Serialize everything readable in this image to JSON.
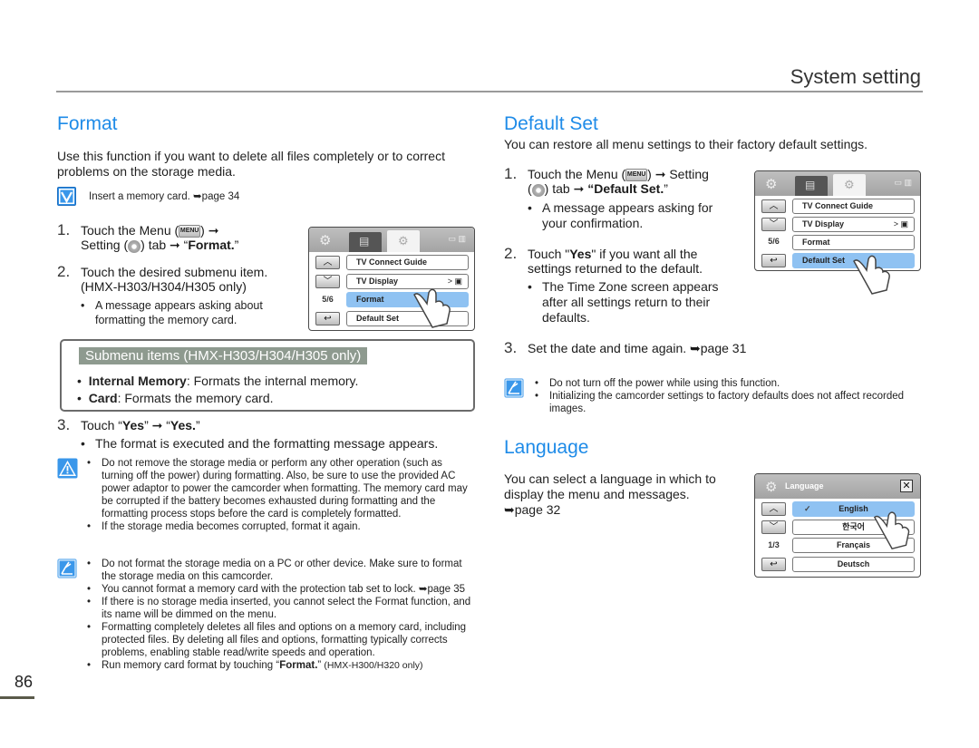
{
  "header": {
    "title": "System setting"
  },
  "page_number": "86",
  "format": {
    "title": "Format",
    "intro": "Use this function if you want to delete all files completely or to correct problems on the storage media.",
    "precheck": {
      "icon": "checkmark-icon",
      "text": "Insert a memory card. ➥page 34"
    },
    "step1": {
      "num": "1.",
      "a": "Touch the Menu (",
      "menu_key": "MENU",
      "b": ") ➞",
      "c": "Setting (",
      "d": ") tab ➞ “",
      "bold": "Format.",
      "e": "”"
    },
    "step2": {
      "num": "2.",
      "line1": "Touch the desired submenu item.",
      "line2": "(HMX-H303/H304/H305 only)"
    },
    "step2_bullet": "A message appears asking about formatting the memory card.",
    "screen": {
      "items": [
        "TV Connect Guide",
        "TV Display",
        "Format",
        "Default Set"
      ],
      "selected_index": 2,
      "page_indicator": "5/6",
      "tv_display_value": ">"
    },
    "submenu": {
      "title": "Submenu items (HMX-H303/H304/H305 only)",
      "items": [
        {
          "bold": "Internal Memory",
          "text": ": Formats the internal memory."
        },
        {
          "bold": "Card",
          "text": ": Formats the memory card."
        }
      ]
    },
    "step3": {
      "num": "3.",
      "a": "Touch “",
      "yes1": "Yes",
      "b": "” ➞ “",
      "yes2": "Yes.",
      "c": "”"
    },
    "step3_bullet": "The format is executed and the formatting message appears.",
    "cautions": [
      "Do not remove the storage media or perform any other operation (such as turning off the power) during formatting. Also, be sure to use the provided AC power adaptor to power the camcorder when formatting. The memory card may be corrupted if the battery becomes exhausted during formatting and the formatting process stops before the card is completely formatted.",
      "If the storage media becomes corrupted, format it again."
    ],
    "notes": [
      "Do not format the storage media on a PC or other device. Make sure to format the storage media on this camcorder.",
      "You cannot format a memory card with the protection tab set to lock. ➥page 35",
      "If there is no storage media inserted, you cannot select the Format function, and its name will be dimmed on the menu.",
      "Formatting completely deletes all files and options on a memory card, including protected files. By deleting all files and options, formatting typically corrects problems, enabling stable read/write speeds and operation."
    ],
    "last_note": {
      "a": "Run memory card format by touching “",
      "bold": "Format.",
      "b": "” ",
      "c": "(HMX-H300/H320 only)"
    }
  },
  "default_set": {
    "title": "Default Set",
    "intro": "You can restore all menu settings to their factory default settings.",
    "step1": {
      "num": "1.",
      "a": "Touch the Menu (",
      "menu_key": "MENU",
      "b": ") ➞ Setting",
      "c": "(",
      "d": ") tab ➞ ",
      "bold": "“Default Set.",
      "e": "”"
    },
    "step1_bullet": "A message appears asking for your confirmation.",
    "step2": {
      "num": "2.",
      "a": "Touch \"",
      "bold": "Yes",
      "b": "\" if you want all the settings returned to the default."
    },
    "step2_bullet": "The Time Zone screen appears after all settings return to their defaults.",
    "step3": {
      "num": "3.",
      "text": "Set the date and time again. ➥page 31"
    },
    "screen": {
      "items": [
        "TV Connect Guide",
        "TV Display",
        "Format",
        "Default Set"
      ],
      "selected_index": 3,
      "page_indicator": "5/6"
    },
    "notes": [
      "Do not turn off the power while using this function.",
      "Initializing the camcorder settings to factory defaults does not affect recorded images."
    ]
  },
  "language": {
    "title": "Language",
    "intro": "You can select a language in which to display the menu and messages.",
    "page_ref": "➥page 32",
    "screen": {
      "title": "Language",
      "items": [
        "English",
        "한국어",
        "Français",
        "Deutsch"
      ],
      "selected_index": 0,
      "page_indicator": "1/3"
    }
  },
  "colors": {
    "accent": "#1e8be8",
    "selected_item": "#8fc2f2",
    "submenu_header": "#8e9a8f"
  }
}
